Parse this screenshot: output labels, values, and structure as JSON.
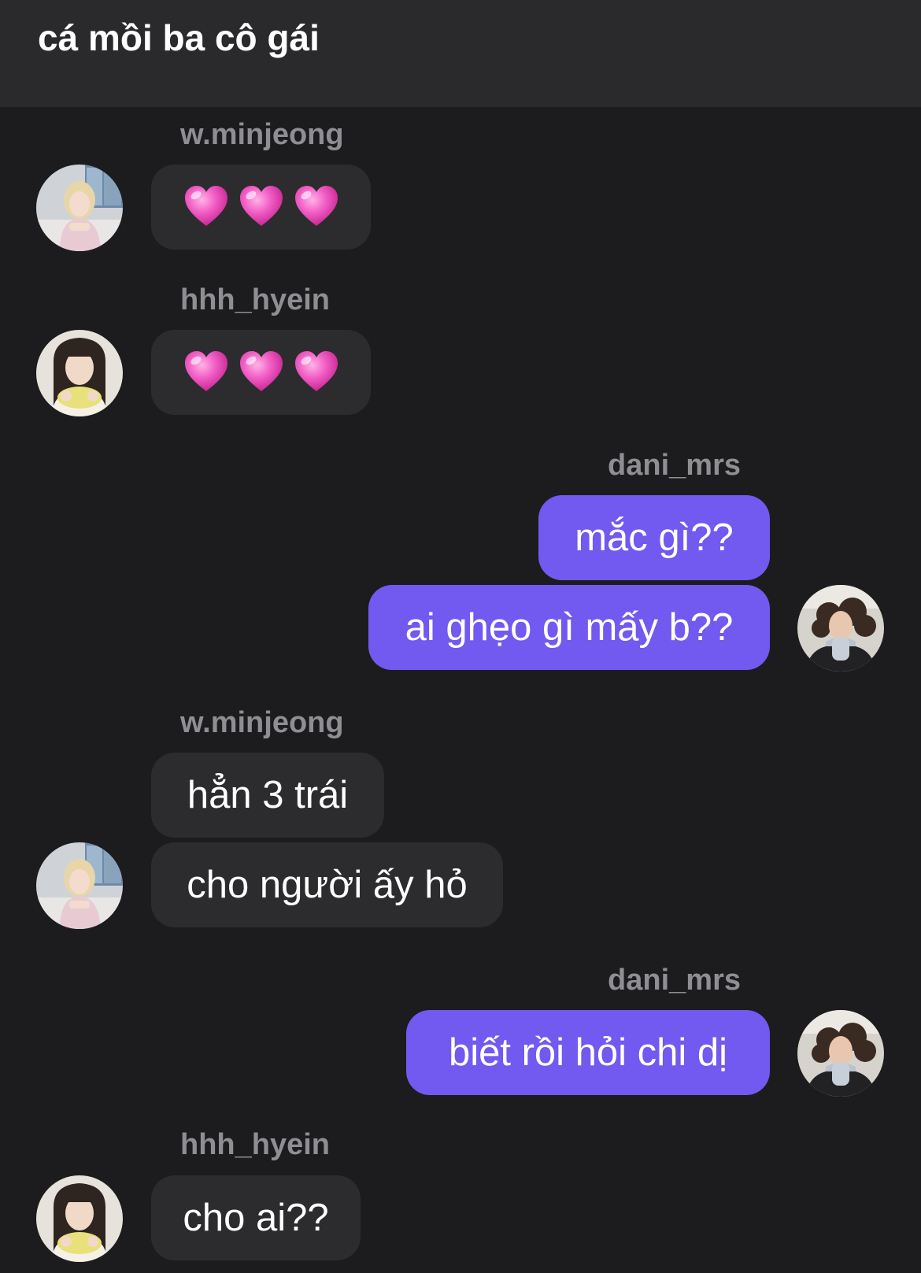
{
  "header": {
    "title": "cá mồi ba cô gái"
  },
  "messages": {
    "s1": "w.minjeong",
    "s2": "hhh_hyein",
    "s3": "dani_mrs",
    "b3a": "mắc gì??",
    "b3b": "ai ghẹo gì mấy b??",
    "s4": "w.minjeong",
    "b4a": "hẳn 3 trái",
    "b4b": "cho người ấy hỏ",
    "s5": "dani_mrs",
    "b5a": "biết rồi hỏi chi dị",
    "s6": "hhh_hyein",
    "b6a": "cho ai??"
  },
  "icons": {
    "heart": "pink-heart-emoji"
  },
  "colors": {
    "background": "#1c1c1e",
    "header_background": "#2a2a2d",
    "incoming_bubble": "#2c2c2e",
    "outgoing_bubble": "#7259f0",
    "sender_name": "#8e8e93"
  }
}
